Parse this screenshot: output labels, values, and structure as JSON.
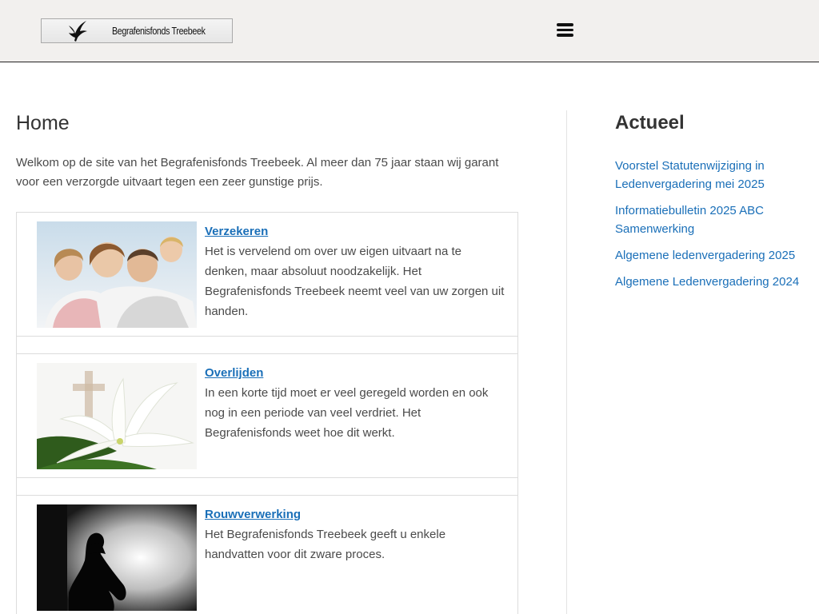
{
  "header": {
    "logo_text": "Begrafenisfonds Treebeek",
    "menu_icon": "hamburger-menu-icon"
  },
  "main": {
    "title": "Home",
    "intro": "Welkom op de site van het Begrafenisfonds Treebeek. Al meer dan 75 jaar staan wij garant voor een verzorgde uitvaart tegen een zeer gunstige prijs.",
    "cards": [
      {
        "title": "Verzekeren",
        "text": "Het is vervelend om over uw eigen uitvaart na te denken, maar absoluut noodzakelijk. Het Begrafenisfonds Treebeek neemt veel van uw zorgen uit handen.",
        "image": "family-photo"
      },
      {
        "title": "Overlijden",
        "text": "In een korte tijd moet er veel geregeld worden en ook nog in een periode van veel verdriet. Het Begrafenisfonds weet hoe dit werkt.",
        "image": "lily-cross-photo"
      },
      {
        "title": "Rouwverwerking",
        "text": "Het Begrafenisfonds Treebeek geeft u enkele handvatten voor dit zware proces.",
        "image": "grieving-silhouette-photo"
      }
    ]
  },
  "sidebar": {
    "title": "Actueel",
    "items": [
      "Voorstel Statutenwijziging in Ledenvergadering mei 2025",
      "Informatiebulletin 2025 ABC Samenwerking",
      "Algemene ledenvergadering 2025",
      "Algemene Ledenvergadering 2024"
    ]
  },
  "colors": {
    "header_bg": "#f2f0ee",
    "link": "#1a6fb8",
    "text": "#4a4a4a"
  }
}
